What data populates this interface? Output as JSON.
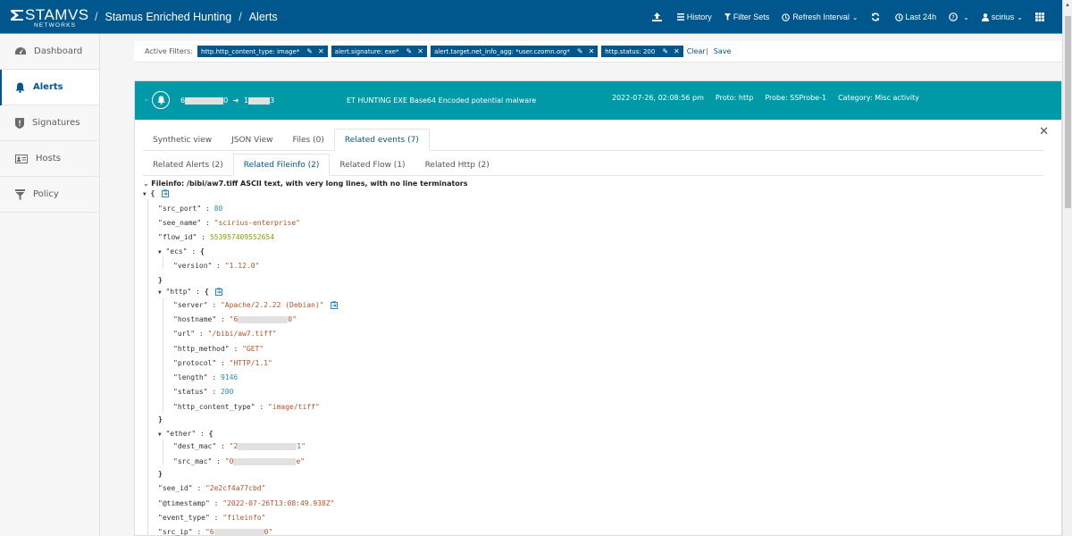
{
  "header": {
    "logo_main": "STAMVS",
    "logo_sub": "NETWORKS",
    "breadcrumb": [
      "Stamus Enriched Hunting",
      "Alerts"
    ],
    "actions": {
      "upload_icon": "upload-icon",
      "history": "History",
      "filter_sets": "Filter Sets",
      "refresh_interval": "Refresh Interval",
      "time_range": "Last 24h",
      "user": "scirius"
    }
  },
  "sidebar": {
    "items": [
      {
        "label": "Dashboard",
        "icon": "dashboard-icon"
      },
      {
        "label": "Alerts",
        "icon": "bell-icon",
        "active": true
      },
      {
        "label": "Signatures",
        "icon": "shield-icon"
      },
      {
        "label": "Hosts",
        "icon": "id-card-icon"
      },
      {
        "label": "Policy",
        "icon": "filter-icon"
      }
    ]
  },
  "filters": {
    "label": "Active Filters:",
    "chips": [
      "http.http_content_type: image*",
      "alert.signature: exe*",
      "alert.target.net_info_agg: *user.czomn.org*",
      "http.status: 200"
    ],
    "clear": "Clear",
    "save": "Save"
  },
  "alert": {
    "src_prefix": "6",
    "src_suffix": "0",
    "dst_prefix": "1",
    "dst_suffix": "3",
    "signature": "ET HUNTING EXE Base64 Encoded potential malware",
    "timestamp": "2022-07-26, 02:08:56 pm",
    "proto": "Proto: http",
    "probe": "Probe: SSProbe-1",
    "category": "Category: Misc activity"
  },
  "tabs": [
    "Synthetic view",
    "JSON View",
    "Files (0)",
    "Related events (7)"
  ],
  "active_tab": "Related events (7)",
  "subtabs": [
    "Related Alerts (2)",
    "Related Fileinfo (2)",
    "Related Flow (1)",
    "Related Http (2)"
  ],
  "active_subtab": "Related Fileinfo (2)",
  "fileinfo": {
    "title": "Fileinfo: /bibi/aw7.tiff ASCII text, with very long lines, with no line terminators",
    "src_port": "80",
    "see_name": "\"scirius-enterprise\"",
    "flow_id": "553957409552654",
    "ecs_version": "\"1.12.0\"",
    "http_server": "\"Apache/2.2.22 (Debian)\"",
    "http_hostname_prefix": "\"6",
    "http_hostname_suffix": "0\"",
    "http_url": "\"/bibi/aw7.tiff\"",
    "http_method": "\"GET\"",
    "http_protocol": "\"HTTP/1.1\"",
    "http_length": "9146",
    "http_status": "200",
    "http_content_type": "\"image/tiff\"",
    "dest_mac_prefix": "\"2",
    "dest_mac_suffix": "1\"",
    "src_mac_prefix": "\"0",
    "src_mac_suffix": "e\"",
    "see_id": "\"2e2cf4a77cbd\"",
    "timestamp": "\"2022-07-26T13:08:49.938Z\"",
    "event_type": "\"fileinfo\"",
    "src_ip_prefix": "\"6",
    "src_ip_suffix": "0\""
  },
  "keys": {
    "src_port": "\"src_port\"",
    "see_name": "\"see_name\"",
    "flow_id": "\"flow_id\"",
    "ecs": "\"ecs\"",
    "version": "\"version\"",
    "http": "\"http\"",
    "server": "\"server\"",
    "hostname": "\"hostname\"",
    "url": "\"url\"",
    "http_method": "\"http_method\"",
    "protocol": "\"protocol\"",
    "length": "\"length\"",
    "status": "\"status\"",
    "http_content_type": "\"http_content_type\"",
    "ether": "\"ether\"",
    "dest_mac": "\"dest_mac\"",
    "src_mac": "\"src_mac\"",
    "see_id": "\"see_id\"",
    "timestamp": "\"@timestamp\"",
    "event_type": "\"event_type\"",
    "src_ip": "\"src_ip\""
  },
  "colors": {
    "brand": "#00578e",
    "alert_header": "#0099a8",
    "string": "#b0532b",
    "number": "#2b8cc4"
  }
}
